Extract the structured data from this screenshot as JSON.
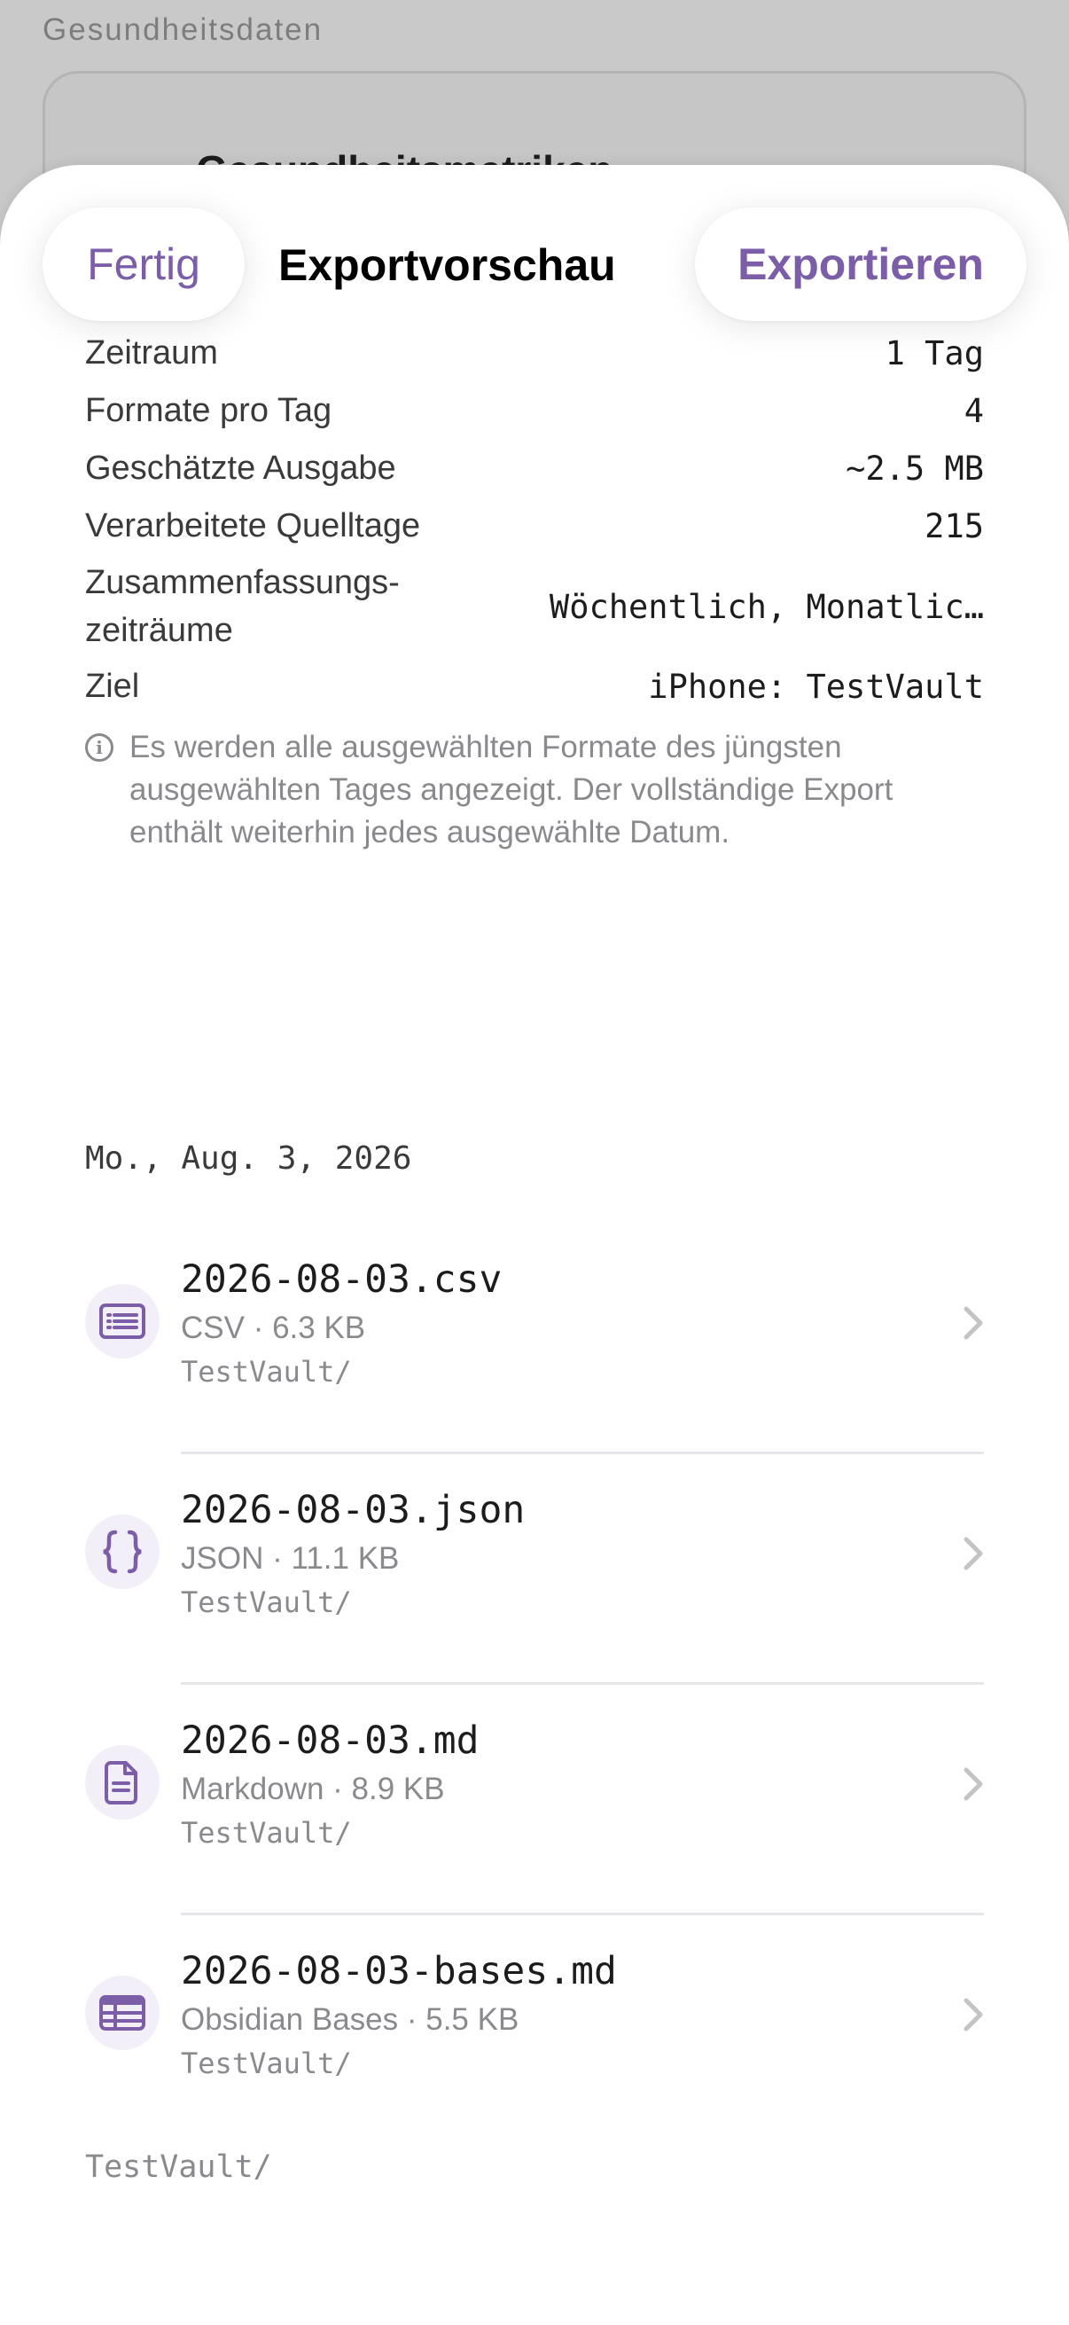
{
  "background": {
    "section_title": "Gesundheitsdaten",
    "card_title": "Gesundheitsmetriken"
  },
  "header": {
    "done_label": "Fertig",
    "title": "Exportvorschau",
    "export_label": "Exportieren"
  },
  "summary": {
    "rows": [
      {
        "label": "Zeitraum",
        "value": "1 Tag"
      },
      {
        "label": "Formate pro Tag",
        "value": "4"
      },
      {
        "label": "Geschätzte Ausgabe",
        "value": "~2.5 MB"
      },
      {
        "label": "Verarbeitete Quelltage",
        "value": "215"
      },
      {
        "label": "Zusammenfassungs-\nzeiträume",
        "value": "Wöchentlich, Monatlic…"
      },
      {
        "label": "Ziel",
        "value": "iPhone: TestVault"
      }
    ],
    "note": "Es werden alle ausgewählten Formate des jüngsten ausgewählten Tages angezeigt. Der vollständige Export enthält weiterhin jedes ausgewählte Datum."
  },
  "date_header": "Mo., Aug. 3, 2026",
  "files": [
    {
      "name": "2026-08-03.csv",
      "meta": "CSV · 6.3 KB",
      "path": "TestVault/",
      "icon": "list-doc-icon"
    },
    {
      "name": "2026-08-03.json",
      "meta": "JSON · 11.1 KB",
      "path": "TestVault/",
      "icon": "curly-braces-icon"
    },
    {
      "name": "2026-08-03.md",
      "meta": "Markdown · 8.9 KB",
      "path": "TestVault/",
      "icon": "document-icon"
    },
    {
      "name": "2026-08-03-bases.md",
      "meta": "Obsidian Bases · 5.5 KB",
      "path": "TestVault/",
      "icon": "table-icon"
    }
  ],
  "footer_path": "TestVault/",
  "colors": {
    "accent": "#7b5ea7",
    "icon_bg": "#f3eff8",
    "secondary_text": "#8a8a8e"
  }
}
